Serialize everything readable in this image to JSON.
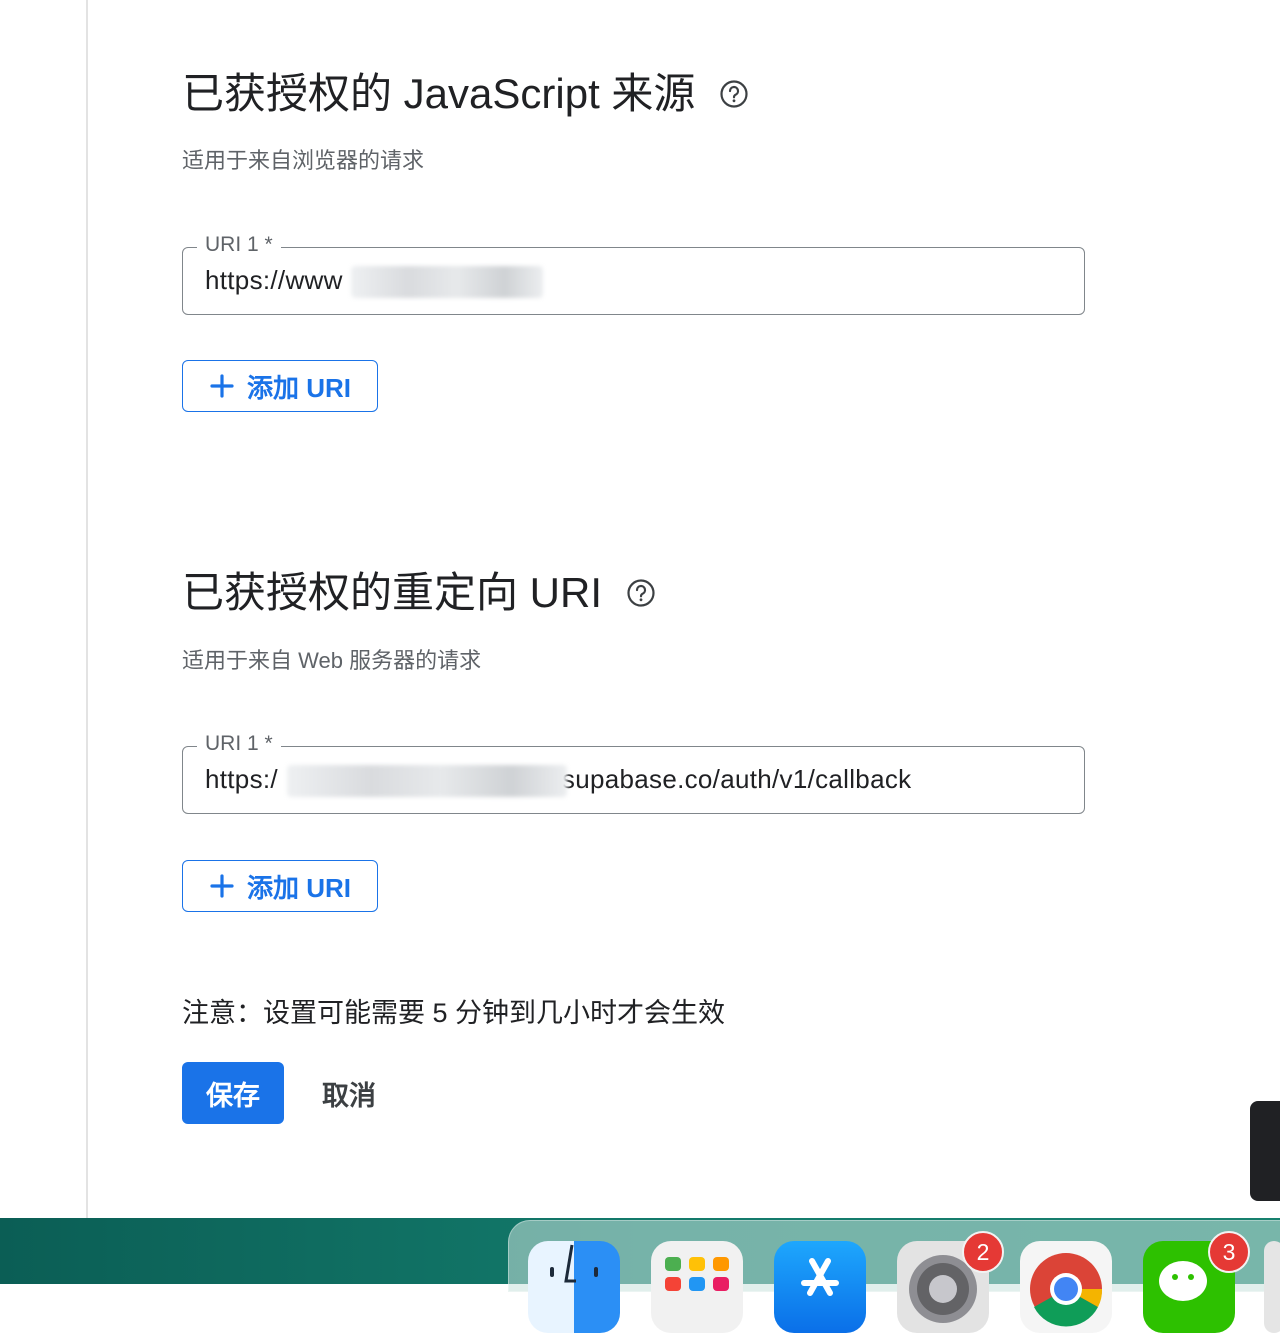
{
  "js_origins": {
    "title": "已获授权的 JavaScript 来源",
    "subtitle": "适用于来自浏览器的请求",
    "uri_label": "URI 1 *",
    "uri_value": "https://www",
    "add_label": "添加 URI"
  },
  "redirect_uris": {
    "title": "已获授权的重定向 URI",
    "subtitle": "适用于来自 Web 服务器的请求",
    "uri_label": "URI 1 *",
    "uri_prefix": "https:/",
    "uri_suffix": "supabase.co/auth/v1/callback",
    "add_label": "添加 URI"
  },
  "note": "注意：设置可能需要 5 分钟到几小时才会生效",
  "actions": {
    "save_label": "保存",
    "cancel_label": "取消"
  },
  "dock": {
    "items": [
      {
        "name": "Finder",
        "icon": "finder-icon"
      },
      {
        "name": "Launchpad",
        "icon": "launchpad-icon"
      },
      {
        "name": "App Store",
        "icon": "app-store-icon"
      },
      {
        "name": "System Settings",
        "icon": "settings-icon",
        "badge": "2"
      },
      {
        "name": "Chrome",
        "icon": "chrome-icon"
      },
      {
        "name": "WeChat",
        "icon": "wechat-icon",
        "badge": "3"
      }
    ]
  },
  "colors": {
    "accent": "#1a73e8",
    "text": "#202124",
    "muted": "#5f6368",
    "badge": "#e53935"
  }
}
